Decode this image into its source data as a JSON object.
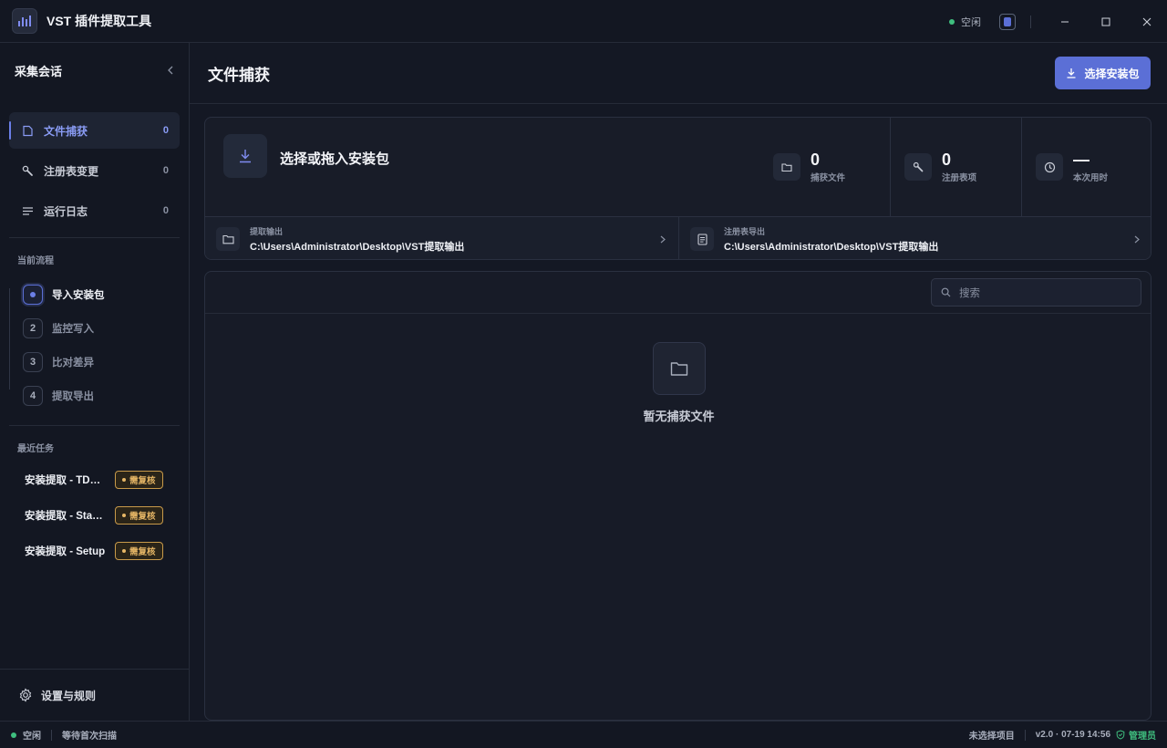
{
  "app": {
    "title": "VST 插件提取工具",
    "status": "空闲"
  },
  "sidebar": {
    "header": "采集会话",
    "nav": [
      {
        "label": "文件捕获",
        "count": "0",
        "icon": "file-icon"
      },
      {
        "label": "注册表变更",
        "count": "0",
        "icon": "wrench-icon"
      },
      {
        "label": "运行日志",
        "count": "0",
        "icon": "list-icon"
      }
    ],
    "workflow_title": "当前流程",
    "steps": [
      {
        "num": "",
        "label": "导入安装包"
      },
      {
        "num": "2",
        "label": "监控写入"
      },
      {
        "num": "3",
        "label": "比对差异"
      },
      {
        "num": "4",
        "label": "提取导出"
      }
    ],
    "recent_title": "最近任务",
    "tasks": [
      {
        "title": "安装提取 - TDR Nova",
        "badge": "需复核"
      },
      {
        "title": "安装提取 - Stadium",
        "badge": "需复核"
      },
      {
        "title": "安装提取 - Setup",
        "badge": "需复核"
      }
    ],
    "settings": "设置与规则"
  },
  "main": {
    "title": "文件捕获",
    "select_button": "选择安装包",
    "drop_title": "选择或拖入安装包",
    "stats": [
      {
        "value": "0",
        "label": "捕获文件"
      },
      {
        "value": "0",
        "label": "注册表项"
      },
      {
        "value": "—",
        "label": "本次用时"
      }
    ],
    "paths": [
      {
        "key": "提取输出",
        "value": "C:\\Users\\Administrator\\Desktop\\VST提取输出"
      },
      {
        "key": "注册表导出",
        "value": "C:\\Users\\Administrator\\Desktop\\VST提取输出"
      }
    ],
    "search_placeholder": "搜索",
    "empty_text": "暂无捕获文件"
  },
  "statusbar": {
    "state": "空闲",
    "message": "等待首次扫描",
    "project": "未选择项目",
    "version": "v2.0 · 07-19 14:56",
    "role": "管理员"
  },
  "colors": {
    "accent": "#5b6fd6",
    "ok": "#3fbf7f",
    "warn": "#e7b766",
    "bg": "#141824"
  }
}
